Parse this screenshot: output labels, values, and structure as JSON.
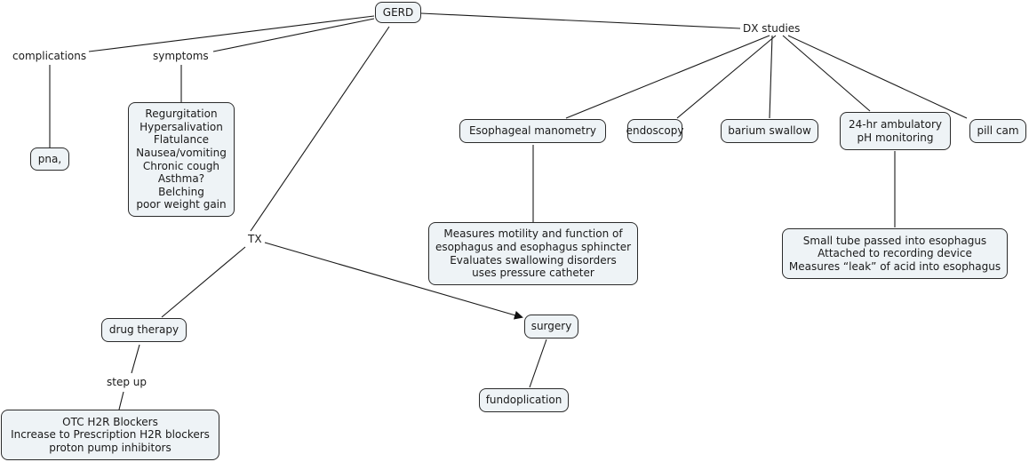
{
  "concept_map": {
    "root": "GERD",
    "linking_phrases": {
      "complications": "complications",
      "symptoms": "symptoms",
      "dx_studies": "DX studies",
      "tx": "TX",
      "step_up": "step up"
    },
    "concepts": {
      "gerd": "GERD",
      "pna": "pna,",
      "symptoms_list": "Regurgitation\nHypersalivation\nFlatulance\nNausea/vomiting\nChronic cough\nAsthma?\nBelching\npoor weight gain",
      "esophageal_manometry": "Esophageal manometry",
      "endoscopy": "endoscopy",
      "barium_swallow": "barium swallow",
      "ph_monitoring": "24-hr ambulatory\npH monitoring",
      "pill_cam": "pill cam",
      "manometry_details": "Measures motility and function of\nesophagus and esophagus sphincter\nEvaluates swallowing disorders\nuses pressure catheter",
      "ph_details": "Small tube passed into esophagus\nAttached to recording device\nMeasures “leak” of acid into esophagus",
      "drug_therapy": "drug therapy",
      "drug_steps": "OTC H2R Blockers\nIncrease to  Prescription H2R blockers\nproton pump inhibitors",
      "surgery": "surgery",
      "fundoplication": "fundoplication"
    },
    "connections": [
      {
        "from": "GERD",
        "to": "complications"
      },
      {
        "from": "GERD",
        "to": "symptoms"
      },
      {
        "from": "GERD",
        "to": "DX studies"
      },
      {
        "from": "GERD",
        "to": "TX"
      },
      {
        "from": "complications",
        "to": "pna,"
      },
      {
        "from": "symptoms",
        "to": "symptoms list"
      },
      {
        "from": "DX studies",
        "to": "Esophageal manometry"
      },
      {
        "from": "DX studies",
        "to": "endoscopy"
      },
      {
        "from": "DX studies",
        "to": "barium swallow"
      },
      {
        "from": "DX studies",
        "to": "24-hr ambulatory pH monitoring"
      },
      {
        "from": "DX studies",
        "to": "pill cam"
      },
      {
        "from": "Esophageal manometry",
        "to": "manometry details"
      },
      {
        "from": "24-hr ambulatory pH monitoring",
        "to": "pH details"
      },
      {
        "from": "TX",
        "to": "drug therapy"
      },
      {
        "from": "TX",
        "to": "surgery",
        "arrow": true
      },
      {
        "from": "drug therapy",
        "to": "step up"
      },
      {
        "from": "step up",
        "to": "drug steps"
      },
      {
        "from": "surgery",
        "to": "fundoplication"
      }
    ]
  }
}
